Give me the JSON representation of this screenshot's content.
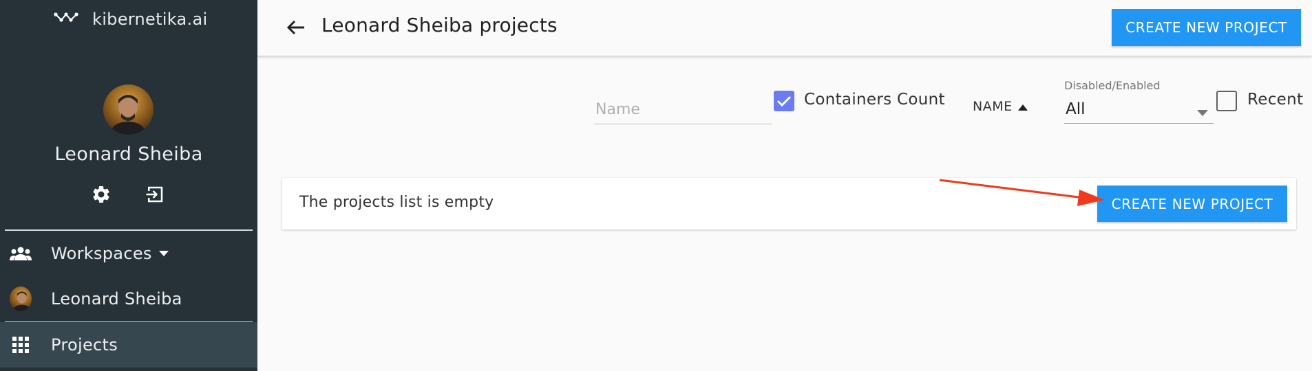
{
  "brand": {
    "name": "kibernetika.ai"
  },
  "user": {
    "name": "Leonard Sheiba"
  },
  "sidebar": {
    "items": [
      {
        "label": "Workspaces",
        "icon": "people-icon"
      },
      {
        "label": "Leonard Sheiba",
        "icon": "avatar"
      },
      {
        "label": "Projects",
        "icon": "apps-grid-icon"
      }
    ]
  },
  "header": {
    "title": "Leonard Sheiba projects",
    "create_button": "CREATE NEW PROJECT"
  },
  "filters": {
    "name_placeholder": "Name",
    "containers_count": {
      "label": "Containers Count",
      "checked": true
    },
    "sort": {
      "label": "NAME"
    },
    "status": {
      "caption": "Disabled/Enabled",
      "value": "All"
    },
    "recent": {
      "label": "Recent",
      "checked": false
    }
  },
  "empty_state": {
    "message": "The projects list is empty",
    "create_button": "CREATE NEW PROJECT"
  },
  "colors": {
    "sidebar_bg": "#263238",
    "primary": "#2196f3",
    "checkbox_checked": "#6b7bf0",
    "annotation_arrow": "#f03a1e"
  }
}
